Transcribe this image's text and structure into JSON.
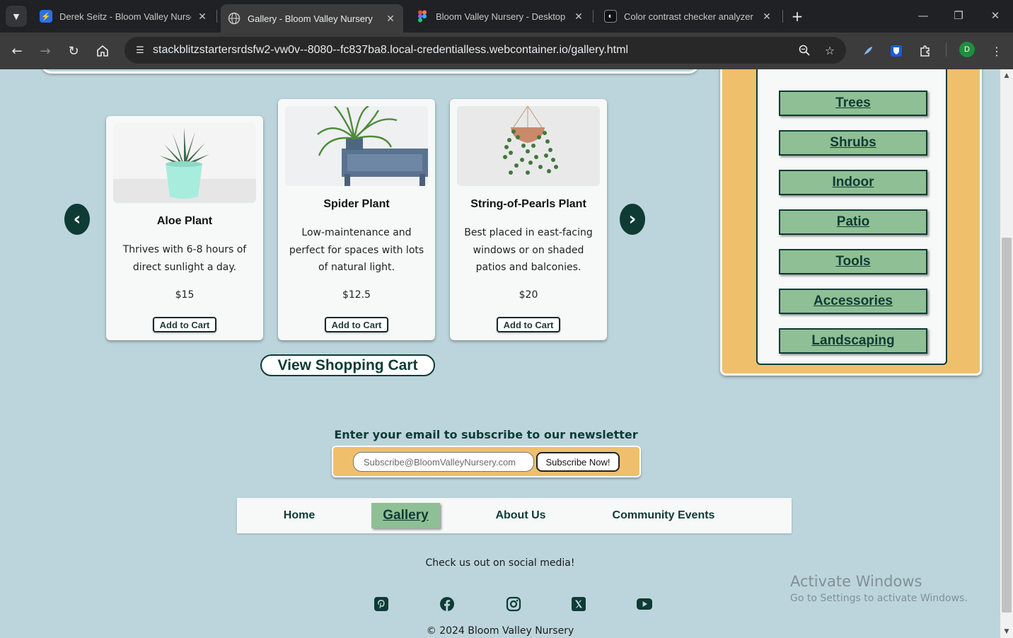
{
  "browser": {
    "tabs": [
      {
        "title": "Derek Seitz - Bloom Valley Nursery",
        "favicon": "bolt-icon",
        "active": false
      },
      {
        "title": "Gallery - Bloom Valley Nursery",
        "favicon": "globe-icon",
        "active": true
      },
      {
        "title": "Bloom Valley Nursery - Desktop",
        "favicon": "figma-icon",
        "active": false
      },
      {
        "title": "Color contrast checker analyzer",
        "favicon": "contrast-icon",
        "active": false
      }
    ],
    "url": "stackblitzstartersrdsfw2-vw0v--8080--fc837ba8.local-credentialless.webcontainer.io/gallery.html",
    "profile_initial": "D"
  },
  "products": [
    {
      "name": "Aloe Plant",
      "desc": "Thrives with 6-8 hours of direct sunlight a day.",
      "price": "$15",
      "button": "Add to Cart"
    },
    {
      "name": "Spider Plant",
      "desc": "Low-maintenance and perfect for spaces with lots of natural light.",
      "price": "$12.5",
      "button": "Add to Cart"
    },
    {
      "name": "String-of-Pearls Plant",
      "desc": "Best placed in east-facing windows or on shaded patios and balconies.",
      "price": "$20",
      "button": "Add to Cart"
    }
  ],
  "view_cart_label": "View Shopping Cart",
  "categories": [
    "Trees",
    "Shrubs",
    "Indoor",
    "Patio",
    "Tools",
    "Accessories",
    "Landscaping"
  ],
  "newsletter": {
    "title": "Enter your email to subscribe to our newsletter",
    "placeholder": "Subscribe@BloomValleyNursery.com",
    "button": "Subscribe Now!"
  },
  "footer_nav": [
    {
      "label": "Home",
      "active": false
    },
    {
      "label": "Gallery",
      "active": true
    },
    {
      "label": "About Us",
      "active": false
    },
    {
      "label": "Community Events",
      "active": false
    }
  ],
  "social": {
    "text": "Check us out on social media!",
    "icons": [
      "pinterest-icon",
      "facebook-icon",
      "instagram-icon",
      "x-icon",
      "youtube-icon"
    ]
  },
  "copyright": "© 2024 Bloom Valley Nursery",
  "watermark": {
    "line1": "Activate Windows",
    "line2": "Go to Settings to activate Windows."
  },
  "colors": {
    "page_bg": "#bcd5dc",
    "brand_dark": "#0e3b34",
    "sage": "#8fbf94",
    "gold": "#f0bf6b"
  }
}
